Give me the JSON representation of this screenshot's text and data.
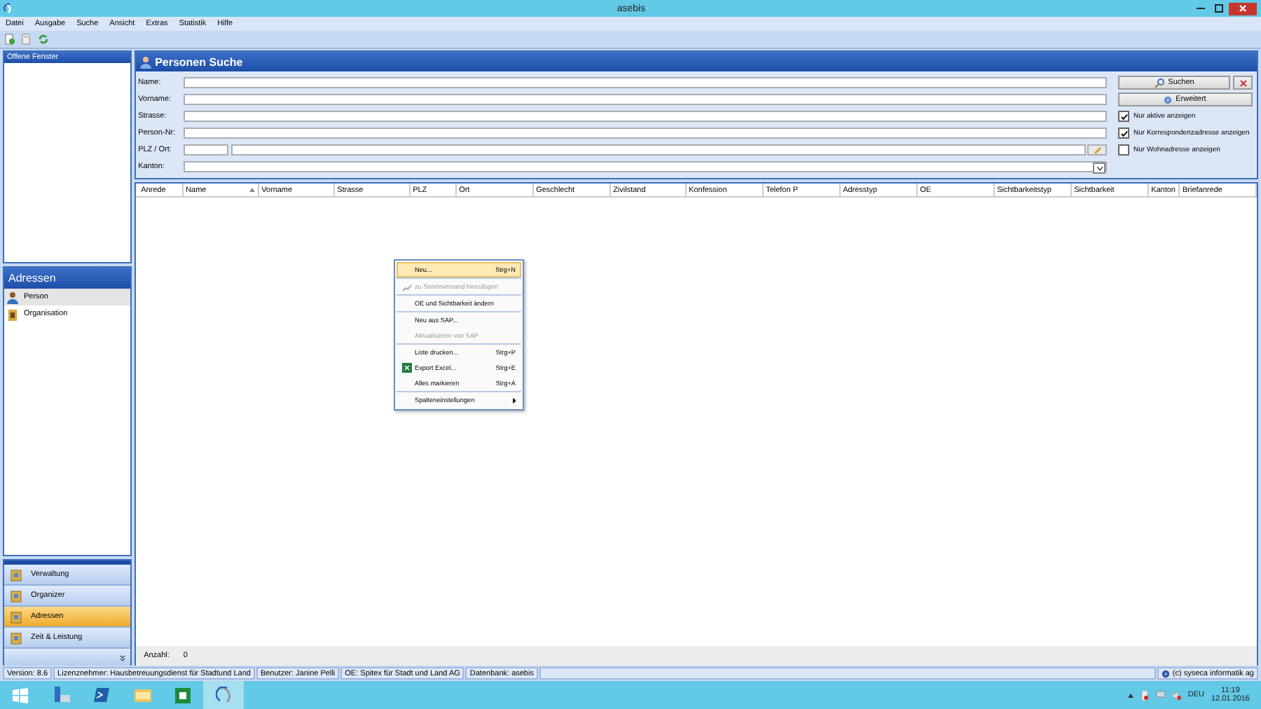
{
  "window": {
    "title": "asebis"
  },
  "menu": [
    {
      "label": "Datei"
    },
    {
      "label": "Ausgabe"
    },
    {
      "label": "Suche"
    },
    {
      "label": "Ansicht"
    },
    {
      "label": "Extras"
    },
    {
      "label": "Statistik"
    },
    {
      "label": "Hilfe"
    }
  ],
  "sidebar": {
    "open_windows": {
      "title": "Offene Fenster"
    },
    "section": {
      "title": "Adressen",
      "items": [
        {
          "label": "Person",
          "selected": true
        },
        {
          "label": "Organisation",
          "selected": false
        }
      ]
    },
    "nav": [
      {
        "label": "Verwaltung",
        "selected": false
      },
      {
        "label": "Organizer",
        "selected": false
      },
      {
        "label": "Adressen",
        "selected": true
      },
      {
        "label": "Zeit & Leistung",
        "selected": false
      }
    ]
  },
  "panel": {
    "title": "Personen Suche",
    "fields": [
      {
        "label": "Name:",
        "kind": "text"
      },
      {
        "label": "Vorname:",
        "kind": "text"
      },
      {
        "label": "Strasse:",
        "kind": "text"
      },
      {
        "label": "Person-Nr:",
        "kind": "text"
      },
      {
        "label": "PLZ / Ort:",
        "kind": "plz"
      },
      {
        "label": "Kanton:",
        "kind": "select"
      }
    ],
    "buttons": [
      {
        "label": "Suchen"
      },
      {
        "label": "Erweitert"
      }
    ],
    "options": [
      {
        "label": "Nur aktive anzeigen",
        "checked": true
      },
      {
        "label": "Nur Korrespondenzadresse anzeigen",
        "checked": true
      },
      {
        "label": "Nur Wohnadresse anzeigen",
        "checked": false
      }
    ],
    "table": {
      "columns": [
        {
          "label": "Anrede",
          "sorted": false
        },
        {
          "label": "Name",
          "sorted": true
        },
        {
          "label": "Vorname",
          "sorted": false
        },
        {
          "label": "Strasse",
          "sorted": false
        },
        {
          "label": "PLZ",
          "sorted": false
        },
        {
          "label": "Ort",
          "sorted": false
        },
        {
          "label": "Geschlecht",
          "sorted": false
        },
        {
          "label": "Zivilstand",
          "sorted": false
        },
        {
          "label": "Konfession",
          "sorted": false
        },
        {
          "label": "Telefon P",
          "sorted": false
        },
        {
          "label": "Adresstyp",
          "sorted": false
        },
        {
          "label": "OE",
          "sorted": false
        },
        {
          "label": "Sichtbarkeitstyp",
          "sorted": false
        },
        {
          "label": "Sichtbarkeit",
          "sorted": false
        },
        {
          "label": "Kanton",
          "sorted": false
        },
        {
          "label": "Briefanrede",
          "sorted": false
        }
      ]
    },
    "footer": {
      "label": "Anzahl:",
      "count": "0"
    }
  },
  "context_menu": {
    "groups": [
      [
        {
          "label": "Neu...",
          "shortcut": "Strg+N",
          "selected": true,
          "disabled": false,
          "kind": "text"
        }
      ],
      [
        {
          "label": "zu Serienversand hinzufügen",
          "selected": false,
          "disabled": true,
          "kind": "icon"
        }
      ],
      [
        {
          "label": "OE und Sichtbarkeit ändern",
          "selected": false,
          "disabled": false,
          "kind": "text"
        }
      ],
      [
        {
          "label": "Neu aus SAP...",
          "selected": false,
          "disabled": false,
          "kind": "text"
        },
        {
          "label": "Aktualisieren von SAP",
          "selected": false,
          "disabled": true,
          "kind": "text"
        }
      ],
      [
        {
          "label": "Liste drucken...",
          "shortcut": "Strg+P",
          "selected": false,
          "disabled": false,
          "kind": "text"
        },
        {
          "label": "Export Excel...",
          "shortcut": "Strg+E",
          "selected": false,
          "disabled": false,
          "kind": "icon"
        },
        {
          "label": "Alles markieren",
          "shortcut": "Strg+A",
          "selected": false,
          "disabled": false,
          "kind": "text"
        }
      ],
      [
        {
          "label": "Spalteneinstellungen",
          "selected": false,
          "disabled": false,
          "kind": "submenu"
        }
      ]
    ]
  },
  "status_bar": {
    "items": [
      "Version: 8.6",
      "Lizenznehmer: Hausbetreuungsdienst für Stadtund Land",
      "Benutzer: Janine Pelli",
      "OE: Spitex für Stadt und Land AG",
      "Datenbank: asebis"
    ],
    "copyright": "(c) syseca informatik ag"
  },
  "taskbar": {
    "apps": [
      {
        "active": false
      },
      {
        "active": false
      },
      {
        "active": false
      },
      {
        "active": false
      },
      {
        "active": false
      },
      {
        "active": true
      }
    ],
    "language": "DEU",
    "time": "11:19",
    "date": "12.01.2016"
  }
}
